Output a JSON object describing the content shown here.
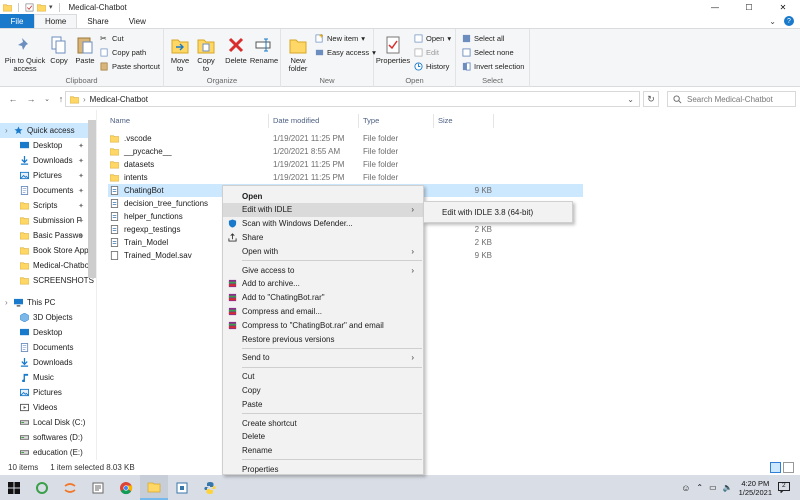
{
  "window": {
    "title": "Medical-Chatbot",
    "controls": {
      "minimize": "—",
      "maximize": "☐",
      "close": "✕"
    }
  },
  "tabs": [
    "File",
    "Home",
    "Share",
    "View"
  ],
  "ribbon": {
    "clipboard": {
      "label": "Clipboard",
      "pin": "Pin to Quick access",
      "copy": "Copy",
      "paste": "Paste",
      "cut": "Cut",
      "copy_path": "Copy path",
      "paste_shortcut": "Paste shortcut"
    },
    "organize": {
      "label": "Organize",
      "move_to": "Move to",
      "copy_to": "Copy to",
      "delete": "Delete",
      "rename": "Rename"
    },
    "new": {
      "label": "New",
      "new_folder": "New folder",
      "new_item": "New item",
      "easy_access": "Easy access"
    },
    "open": {
      "label": "Open",
      "properties": "Properties",
      "open": "Open",
      "edit": "Edit",
      "history": "History"
    },
    "select": {
      "label": "Select",
      "select_all": "Select all",
      "select_none": "Select none",
      "invert": "Invert selection"
    }
  },
  "address": {
    "path": "Medical-Chatbot",
    "search_placeholder": "Search Medical-Chatbot"
  },
  "sidebar": {
    "items": [
      {
        "label": "Quick access",
        "icon": "star-icon",
        "pinned": false,
        "selected": true
      },
      {
        "label": "Desktop",
        "icon": "desktop-icon",
        "pinned": true
      },
      {
        "label": "Downloads",
        "icon": "download-icon",
        "pinned": true
      },
      {
        "label": "Pictures",
        "icon": "pictures-icon",
        "pinned": true
      },
      {
        "label": "Documents",
        "icon": "documents-icon",
        "pinned": true
      },
      {
        "label": "Scripts",
        "icon": "folder-icon",
        "pinned": true
      },
      {
        "label": "Submission P",
        "icon": "folder-icon",
        "pinned": true
      },
      {
        "label": "Basic Passwo",
        "icon": "folder-icon",
        "pinned": true
      },
      {
        "label": "Book Store App",
        "icon": "folder-icon",
        "pinned": false
      },
      {
        "label": "Medical-Chatbo",
        "icon": "folder-icon",
        "pinned": false
      },
      {
        "label": "SCREENSHOTS",
        "icon": "folder-icon",
        "pinned": false
      },
      {
        "label": "This PC",
        "icon": "pc-icon",
        "pinned": false
      },
      {
        "label": "3D Objects",
        "icon": "cube-icon",
        "pinned": false
      },
      {
        "label": "Desktop",
        "icon": "desktop-icon",
        "pinned": false
      },
      {
        "label": "Documents",
        "icon": "documents-icon",
        "pinned": false
      },
      {
        "label": "Downloads",
        "icon": "download-icon",
        "pinned": false
      },
      {
        "label": "Music",
        "icon": "music-icon",
        "pinned": false
      },
      {
        "label": "Pictures",
        "icon": "pictures-icon",
        "pinned": false
      },
      {
        "label": "Videos",
        "icon": "video-icon",
        "pinned": false
      },
      {
        "label": "Local Disk (C:)",
        "icon": "drive-icon",
        "pinned": false
      },
      {
        "label": "softwares (D:)",
        "icon": "drive-icon",
        "pinned": false
      },
      {
        "label": "education (E:)",
        "icon": "drive-icon",
        "pinned": false
      }
    ]
  },
  "columns": {
    "name": "Name",
    "date": "Date modified",
    "type": "Type",
    "size": "Size"
  },
  "files": [
    {
      "name": ".vscode",
      "date": "1/19/2021 11:25 PM",
      "type": "File folder",
      "size": "",
      "kind": "folder"
    },
    {
      "name": "__pycache__",
      "date": "1/20/2021 8:55 AM",
      "type": "File folder",
      "size": "",
      "kind": "folder"
    },
    {
      "name": "datasets",
      "date": "1/19/2021 11:25 PM",
      "type": "File folder",
      "size": "",
      "kind": "folder"
    },
    {
      "name": "intents",
      "date": "1/19/2021 11:25 PM",
      "type": "File folder",
      "size": "",
      "kind": "folder"
    },
    {
      "name": "ChatingBot",
      "date": "",
      "type": "",
      "size": "9 KB",
      "kind": "py",
      "selected": true
    },
    {
      "name": "decision_tree_functions",
      "date": "",
      "type": "",
      "size": "",
      "kind": "py"
    },
    {
      "name": "helper_functions",
      "date": "",
      "type": "",
      "size": "",
      "kind": "py"
    },
    {
      "name": "regexp_testings",
      "date": "",
      "type": "",
      "size": "2 KB",
      "kind": "py"
    },
    {
      "name": "Train_Model",
      "date": "",
      "type": "",
      "size": "2 KB",
      "kind": "py"
    },
    {
      "name": "Trained_Model.sav",
      "date": "",
      "type": "",
      "size": "9 KB",
      "kind": "file"
    }
  ],
  "context_menu": {
    "items": [
      {
        "label": "Open",
        "bold": true
      },
      {
        "label": "Edit with IDLE",
        "arrow": true,
        "hover": true
      },
      {
        "label": "Scan with Windows Defender...",
        "icon": "defender-icon"
      },
      {
        "label": "Share",
        "icon": "share-icon"
      },
      {
        "label": "Open with",
        "arrow": true
      },
      {
        "sep": true
      },
      {
        "label": "Give access to",
        "arrow": true
      },
      {
        "label": "Add to archive...",
        "icon": "winrar-icon"
      },
      {
        "label": "Add to \"ChatingBot.rar\"",
        "icon": "winrar-icon"
      },
      {
        "label": "Compress and email...",
        "icon": "winrar-icon"
      },
      {
        "label": "Compress to \"ChatingBot.rar\" and email",
        "icon": "winrar-icon"
      },
      {
        "label": "Restore previous versions"
      },
      {
        "sep": true
      },
      {
        "label": "Send to",
        "arrow": true
      },
      {
        "sep": true
      },
      {
        "label": "Cut"
      },
      {
        "label": "Copy"
      },
      {
        "label": "Paste"
      },
      {
        "sep": true
      },
      {
        "label": "Create shortcut"
      },
      {
        "label": "Delete"
      },
      {
        "label": "Rename"
      },
      {
        "sep": true
      },
      {
        "label": "Properties"
      }
    ],
    "submenu": "Edit with IDLE 3.8 (64-bit)"
  },
  "status": {
    "count": "10 items",
    "selected": "1 item selected  8.03 KB"
  },
  "taskbar": {
    "time": "4:20 PM",
    "date": "1/25/2021",
    "notifications": "2"
  },
  "colors": {
    "accent": "#1979ca",
    "selection": "#cce8ff",
    "folder": "#ffd766"
  }
}
